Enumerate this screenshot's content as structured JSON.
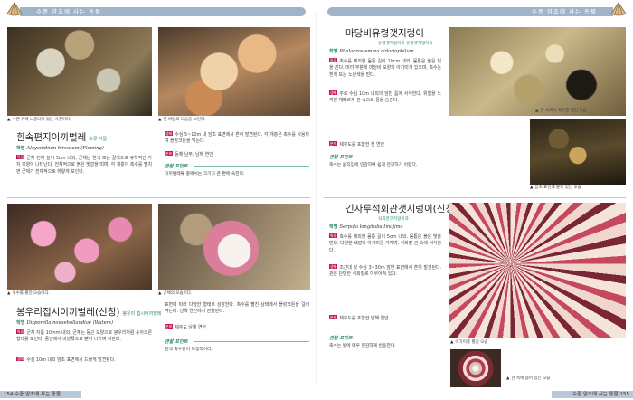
{
  "header": {
    "left_text": "수중 암초에 사는 동물",
    "right_text": "수중 암초에 사는 동물"
  },
  "left_page": {
    "top": {
      "caption_1": "수면 위에 노출되어 있는 사진이다.",
      "caption_2": "흰 바탕의 모습을 보인다.",
      "title": "흰속편지이끼벌레",
      "title_sub": "조류 식물",
      "sci_label": "학명",
      "sci_name": "Alcyonidium hirsutum (Fleming)",
      "feature_label": "특징",
      "feature_text": "군체 전체 높이 5cm 내외, 군체는 흰색 또는 갈색으로 규칙적인 가지 모양이 나타난다. 전체적으로 붉은 빛깔을 띠며, 각 개충이 촉수를 펼치면 군체가 전체적으로 하얗게 보인다.",
      "ecology_label": "생태",
      "ecology_text": "수심 5~10m 내 암초 표면에서 흔히 발견된다. 각 개충은 촉수를 사용하여 플랑크톤을 먹는다.",
      "dist_label": "분포",
      "dist_text": "동해 남부, 남해 연안",
      "tip_head": "관찰 포인트",
      "tip_text": "이끼벌레류 중에서는 크기가 큰 편에 속한다."
    },
    "bottom": {
      "caption_1": "촉수를 펼친 모습이다.",
      "caption_2": "군체의 모습이다.",
      "title": "봉우리접시이끼벌레(신칭)",
      "title_sub": "봉우리 접시이끼벌레",
      "sci_label": "학명",
      "sci_name": "Disporella novaehollandiae (Waters)",
      "feature_label": "특징",
      "feature_text": "군체 지름 10mm 내외, 군체는 둥근 모양으로 봉우리처럼 솟아오른 형태를 보인다. 중앙에서 바깥쪽으로 뻗어 나가며 자란다.",
      "ecology_label": "생태",
      "ecology_text": "수심 10m 내외 암초 표면에서 드물게 발견된다.",
      "right_col_text": "표면에 따라 다양한 형태로 성장한다. 촉수를 펼친 상태에서 플랑크톤을 걸러 먹는다. 남해 연안에서 관찰된다.",
      "dist_label": "분포",
      "dist_text": "제주도 남해 연안",
      "tip_head": "관찰 포인트",
      "tip_text": "흰색 촉수관이 특징적이다."
    }
  },
  "right_page": {
    "top": {
      "title": "마당비유령갯지렁이",
      "subname": "유령갯지렁이과 유령갯지렁이속",
      "sci_label": "학명",
      "sci_name": "Phalacrostemma cidariophilum",
      "feature_label": "특징",
      "feature_text": "촉수를 제외한 몸통 길이 10cm 내외. 몸통은 붉은 빛을 띤다. 머리 부분에 마당비 모양의 아가미가 있으며, 촉수는 흰색 또는 노란색을 띤다.",
      "ecology_label": "생태",
      "ecology_text": "주로 수심 10m 내외의 암반 틈에 서식한다. 위험을 느끼면 재빠르게 관 속으로 몸을 숨긴다.",
      "dist_label": "분포",
      "dist_text": "제주도를 포함한 전 연안",
      "tip_head": "관찰 포인트",
      "tip_text": "촉수는 움직임에 민감하여 쉽게 관찰하기 어렵다.",
      "caption_1": "관 속에서 촉수를 펼친 모습",
      "caption_2": "암초 표면에 붙어 있는 모습"
    },
    "bottom": {
      "title": "긴자루석회관갯지렁이(신칭)",
      "subname": "석회관갯지렁이과",
      "sci_label": "학명",
      "sci_name": "Serpula longituba Imajima",
      "feature_label": "특징",
      "feature_text": "촉수를 제외한 몸통 길이 5cm 내외. 몸통은 붉은 빛을 띤다. 다양한 색깔의 아가미를 가지며, 석회질 관 속에 서식한다.",
      "ecology_label": "생태",
      "ecology_text": "조간대 및 수심 3~30m 암반 표면에서 흔히 발견된다. 관은 단단한 석회질로 이루어져 있다.",
      "dist_label": "분포",
      "dist_text": "제주도를 포함한 남해 연안",
      "tip_head": "관찰 포인트",
      "tip_text": "촉수는 빛에 매우 민감하게 반응한다.",
      "caption_1": "아가미를 펼친 모습",
      "caption_2": "관 속에 숨어 있는 모습"
    }
  },
  "footer": {
    "left_text": "154 수중 암초에 사는 동물",
    "right_text": "수중 암초에 사는 동물 155"
  }
}
